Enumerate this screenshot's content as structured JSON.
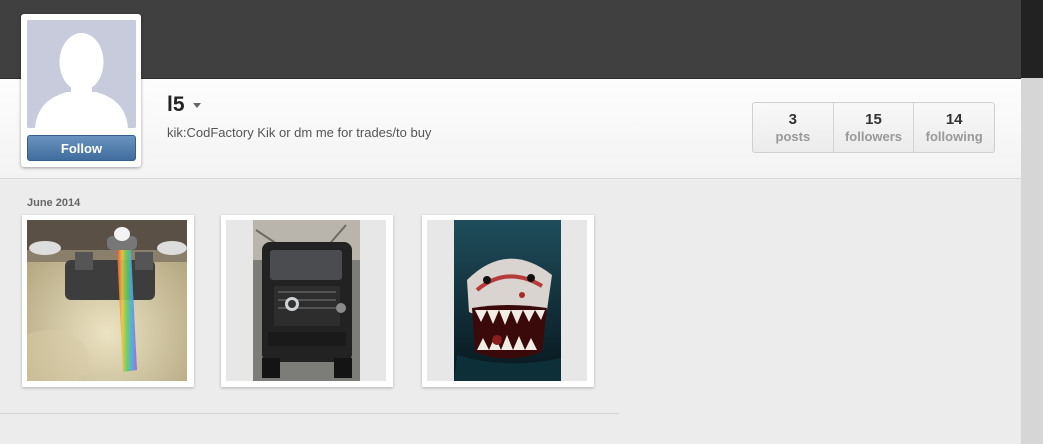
{
  "profile": {
    "username": "l5",
    "bio": "kik:CodFactory Kik or dm me for trades/to buy",
    "follow_label": "Follow"
  },
  "stats": [
    {
      "value": "3",
      "label": "posts"
    },
    {
      "value": "15",
      "label": "followers"
    },
    {
      "value": "14",
      "label": "following"
    }
  ],
  "feed": {
    "date_label": "June 2014",
    "photos": [
      {
        "subject": "faucet-rainbow"
      },
      {
        "subject": "black-suv"
      },
      {
        "subject": "shark"
      }
    ]
  },
  "colors": {
    "topbar": "#404040",
    "follow_button": "#4a76a8",
    "avatar_bg": "#c7cbdc"
  }
}
